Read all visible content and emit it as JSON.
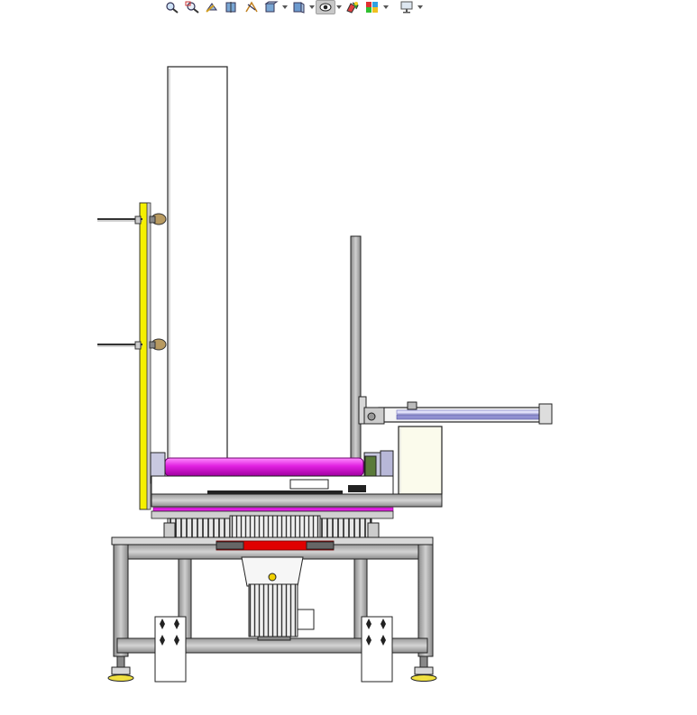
{
  "app": {
    "title": "",
    "view": "Front"
  },
  "toolbar": {
    "buttons": [
      {
        "name": "zoom-to-fit-icon",
        "dropdown": false
      },
      {
        "name": "zoom-to-area-icon",
        "dropdown": false
      },
      {
        "name": "previous-view-icon",
        "dropdown": false
      },
      {
        "name": "section-view-icon",
        "dropdown": false
      },
      {
        "name": "dynamic-annotation-views-icon",
        "dropdown": false
      },
      {
        "name": "view-orientation-icon",
        "dropdown": true
      },
      {
        "name": "display-style-icon",
        "dropdown": true
      },
      {
        "name": "hide-show-items-icon",
        "dropdown": true,
        "pressed": true
      },
      {
        "name": "edit-appearance-icon",
        "dropdown": false
      },
      {
        "name": "apply-scene-icon",
        "dropdown": true
      },
      {
        "name": "view-settings-icon",
        "dropdown": true
      }
    ]
  },
  "colors": {
    "background": "#ffffff",
    "frame_steel": "#b4b4b4",
    "roller_magenta": "#e020e0",
    "guide_yellow": "#f5f000",
    "motor_body": "#d8d8d8",
    "safety_red": "#e00000",
    "outline": "#222222"
  }
}
